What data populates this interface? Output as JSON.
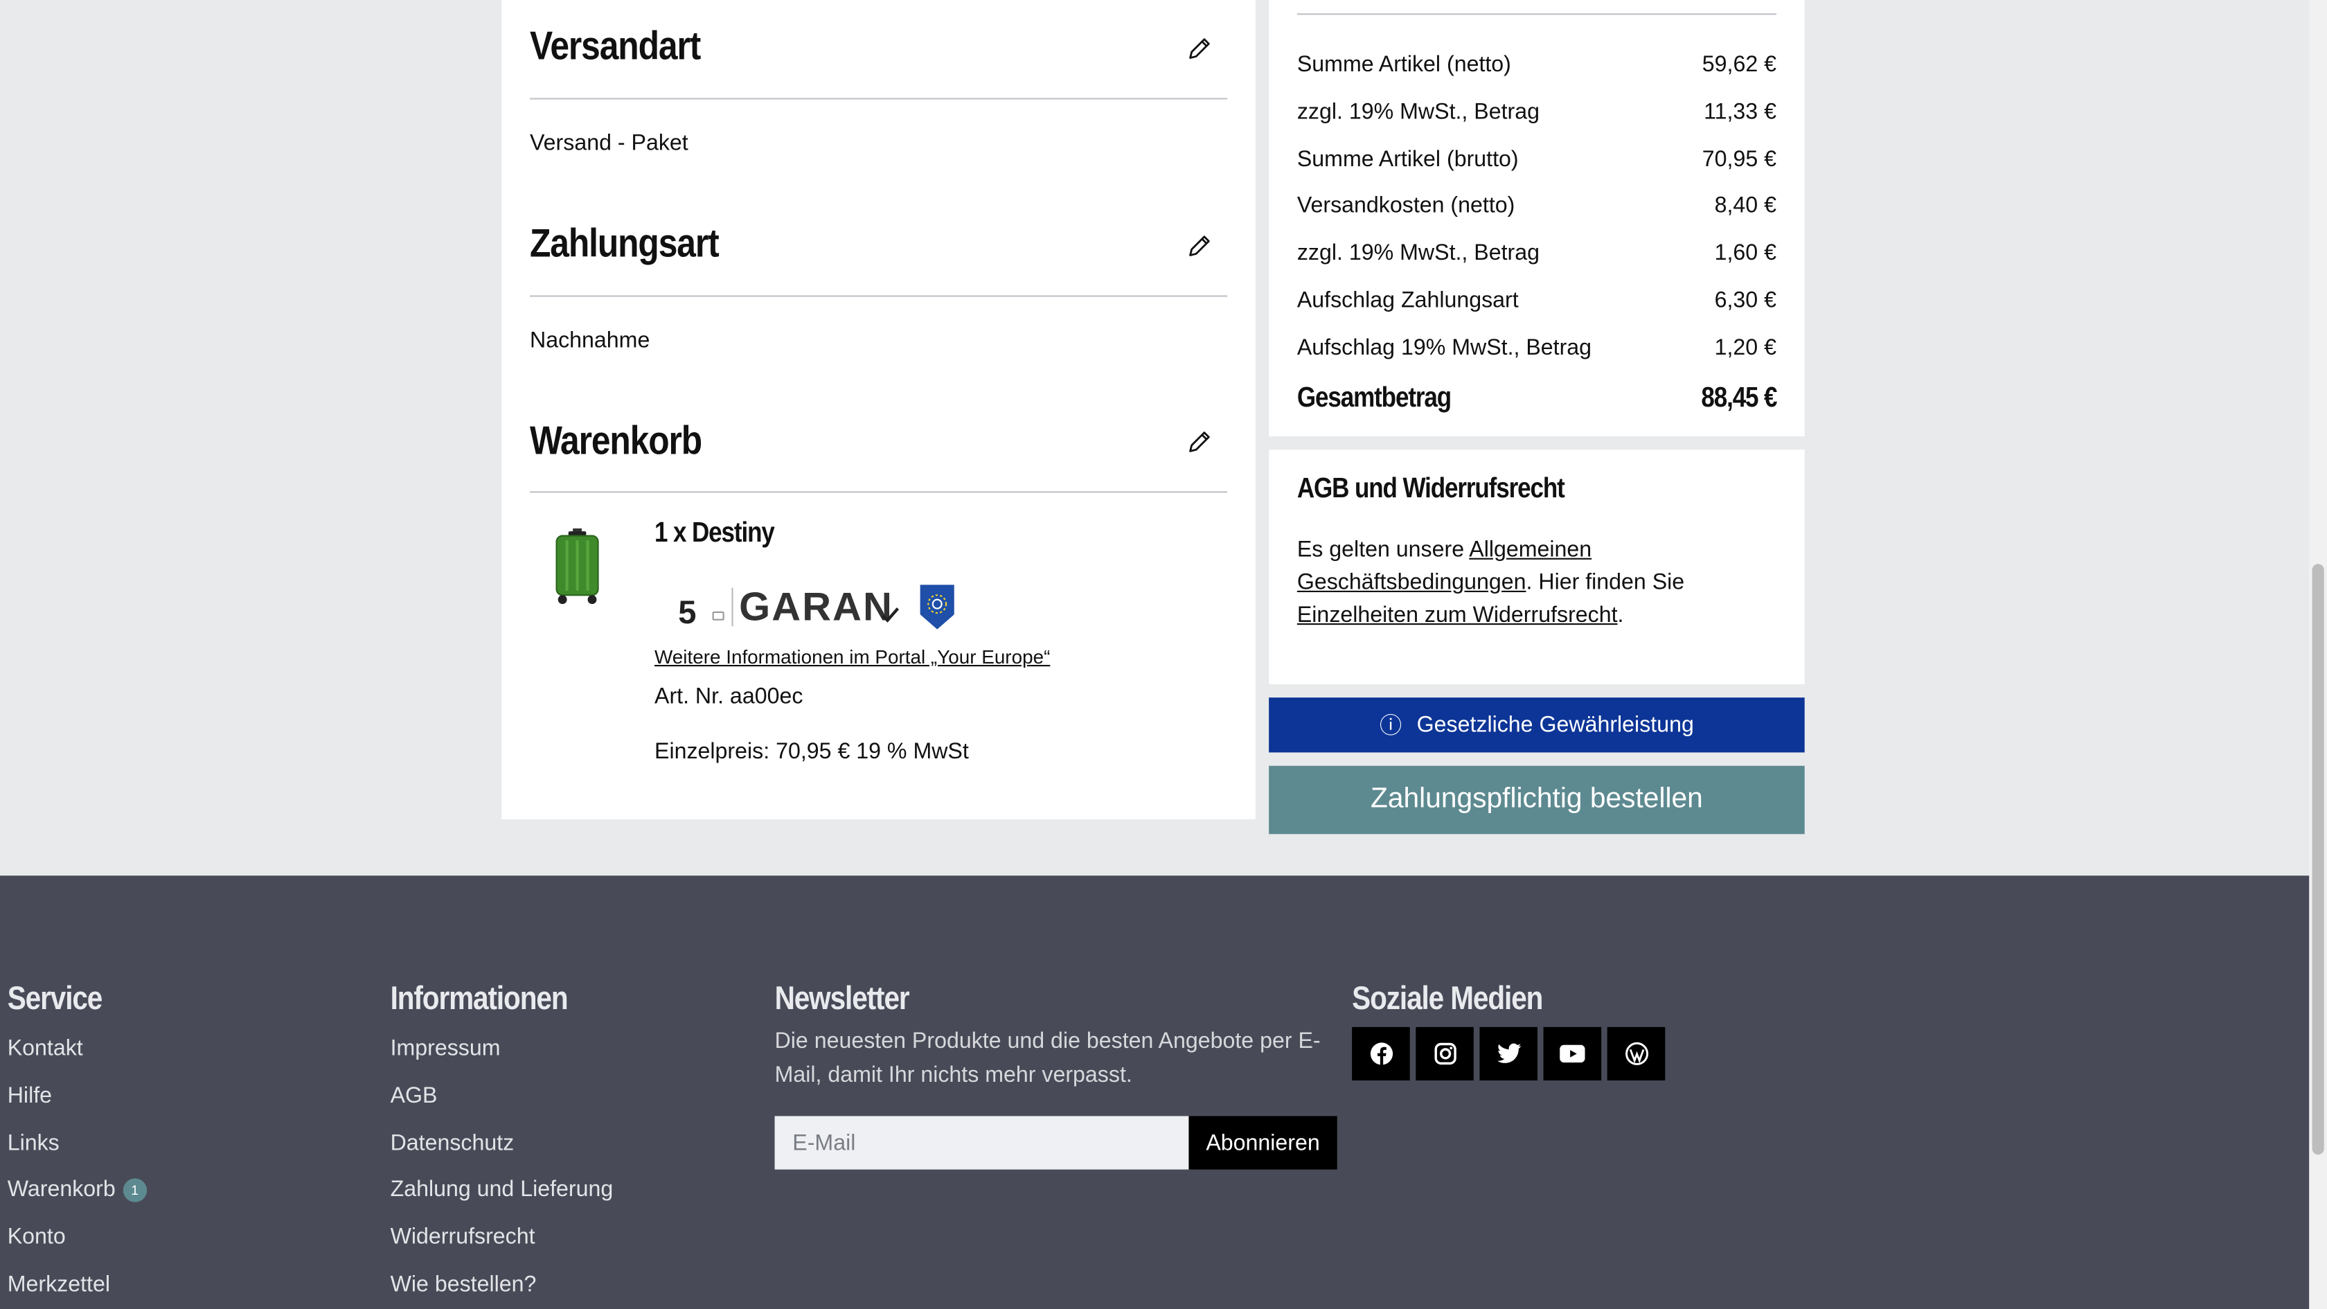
{
  "shipping": {
    "title": "Versandart",
    "value": "Versand - Paket"
  },
  "payment": {
    "title": "Zahlungsart",
    "value": "Nachnahme"
  },
  "cart": {
    "title": "Warenkorb",
    "item_title": "1 x Destiny",
    "badge_number": "5",
    "badge_text": "GARAN",
    "portal_link": "Weitere Informationen im Portal „Your Europe“",
    "art_nr": "Art. Nr. aa00ec",
    "unit_price": "Einzelpreis: 70,95 € 19 % MwSt"
  },
  "summary": {
    "rows": [
      {
        "label": "Summe Artikel (netto)",
        "value": "59,62 €"
      },
      {
        "label": "zzgl. 19% MwSt., Betrag",
        "value": "11,33 €"
      },
      {
        "label": "Summe Artikel (brutto)",
        "value": "70,95 €"
      },
      {
        "label": "Versandkosten (netto)",
        "value": "8,40 €"
      },
      {
        "label": "zzgl. 19% MwSt., Betrag",
        "value": "1,60 €"
      },
      {
        "label": "Aufschlag Zahlungsart",
        "value": "6,30 €"
      },
      {
        "label": "Aufschlag 19% MwSt., Betrag",
        "value": "1,20 €"
      }
    ],
    "total_label": "Gesamtbetrag",
    "total_value": "88,45 €"
  },
  "agb": {
    "title": "AGB und Widerrufsrecht",
    "text_1": "Es gelten unsere ",
    "link_1": "Allgemeinen Geschäftsbedingungen",
    "text_2": ".  Hier finden Sie ",
    "link_2": "Einzelheiten zum Widerrufsrecht",
    "text_3": "."
  },
  "buttons": {
    "warranty_icon": "ⓘ",
    "warranty": "Gesetzliche Gewährleistung",
    "order": "Zahlungspflichtig bestellen"
  },
  "footer": {
    "service": {
      "title": "Service",
      "links": [
        "Kontakt",
        "Hilfe",
        "Links",
        "Warenkorb",
        "Konto",
        "Merkzettel"
      ],
      "cart_count": "1"
    },
    "info": {
      "title": "Informationen",
      "links": [
        "Impressum",
        "AGB",
        "Datenschutz",
        "Zahlung und Lieferung",
        "Widerrufsrecht",
        "Wie bestellen?"
      ]
    },
    "newsletter": {
      "title": "Newsletter",
      "text": "Die neuesten Produkte und die besten Angebote per E-Mail, damit Ihr nichts mehr verpasst.",
      "placeholder": "E-Mail",
      "button": "Abonnieren"
    },
    "social": {
      "title": "Soziale Medien",
      "icons": [
        "facebook-icon",
        "instagram-icon",
        "twitter-icon",
        "youtube-icon",
        "wordpress-icon"
      ]
    }
  },
  "colors": {
    "warranty_bg": "#0d3597",
    "order_bg": "#5d8a90",
    "footer_bg": "#484b57"
  }
}
